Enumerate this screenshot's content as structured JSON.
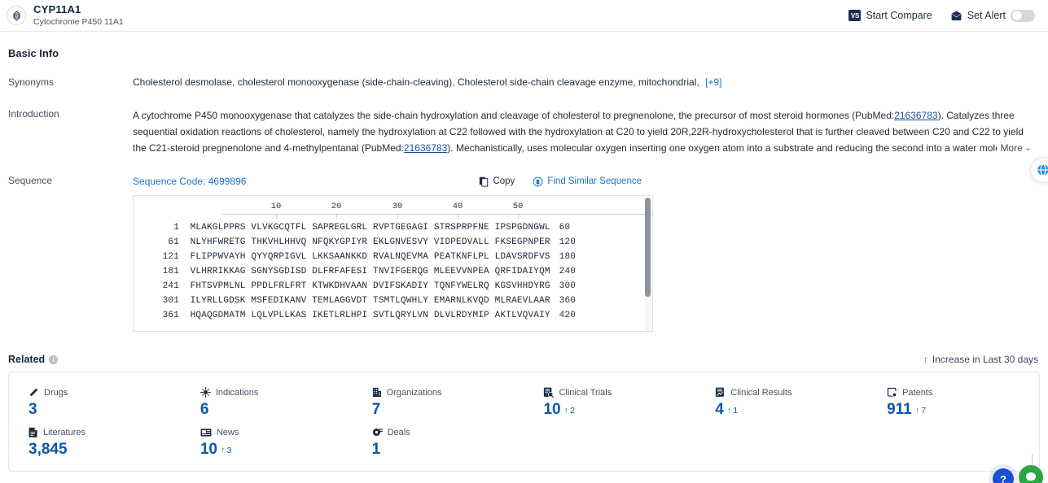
{
  "header": {
    "icon": "target-icon",
    "title": "CYP11A1",
    "subtitle": "Cytochrome P450 11A1",
    "compare_badge": "VS",
    "compare_label": "Start Compare",
    "alert_icon": "alert-envelope-icon",
    "alert_label": "Set Alert",
    "alert_toggle_state": "off"
  },
  "basic_info": {
    "section_title": "Basic Info",
    "synonyms": {
      "label": "Synonyms",
      "text": "Cholesterol desmolase,  cholesterol monooxygenase (side-chain-cleaving),  Cholesterol side-chain cleavage enzyme, mitochondrial,",
      "more_count": "[+9]"
    },
    "introduction": {
      "label": "Introduction",
      "part1": "A cytochrome P450 monooxygenase that catalyzes the side-chain hydroxylation and cleavage of cholesterol to pregnenolone, the precursor of most steroid hormones (PubMed:",
      "pubmed1": "21636783",
      "part2": "). Catalyzes three sequential oxidation reactions of cholesterol, namely the hydroxylation at C22 followed with the hydroxylation at C20 to yield 20R,22R-hydroxycholesterol that is further cleaved between C20 and C22 to yield the C21-steroid pregnenolone and 4-methylpentanal (PubMed:",
      "pubmed2": "21636783",
      "part3": "). Mechanistically, uses molecular oxygen inserting one oxygen atom into a substrate and reducing the second into a water molecule. Two electrons are provided",
      "more_label": "More",
      "more_chevron": "⌄"
    },
    "sequence": {
      "label": "Sequence",
      "code_label": "Sequence Code: 4699896",
      "copy_label": "Copy",
      "copy_icon": "copy-icon",
      "similar_label": "Find Similar Sequence",
      "similar_icon": "find-similar-icon",
      "ruler_ticks": [
        "10",
        "20",
        "30",
        "40",
        "50"
      ],
      "lines": [
        {
          "start": "1",
          "blocks": "MLAKGLPPRS VLVKGCQTFL SAPREGLGRL RVPTGEGAGI STRSPRPFNE IPSPGDNGWL",
          "end": "60"
        },
        {
          "start": "61",
          "blocks": "NLYHFWRETG THKVHLHHVQ NFQKYGPIYR EKLGNVESVY VIDPEDVALL FKSEGPNPER",
          "end": "120"
        },
        {
          "start": "121",
          "blocks": "FLIPPWVAYH QYYQRPIGVL LKKSAANKKD RVALNQEVMA PEATKNFLPL LDAVSRDFVS",
          "end": "180"
        },
        {
          "start": "181",
          "blocks": "VLHRRIKKAG SGNYSGDISD DLFRFAFESI TNVIFGERQG MLEEVVNPEA QRFIDAIYQM",
          "end": "240"
        },
        {
          "start": "241",
          "blocks": "FHTSVPMLNL PPDLFRLFRT KTWKDHVAAN DVIFSKADIY TQNFYWELRQ KGSVHHDYRG",
          "end": "300"
        },
        {
          "start": "301",
          "blocks": "ILYRLLGDSK MSFEDIKANV TEMLAGGVDT TSMTLQWHLY EMARNLKVQD MLRAEVLAAR",
          "end": "360"
        },
        {
          "start": "361",
          "blocks": "HQAQGDMATM LQLVPLLKAS IKETLRLHPI SVTLQRYLVN DLVLRDYMIP AKTLVQVAIY",
          "end": "420"
        }
      ]
    }
  },
  "related": {
    "title": "Related",
    "info_icon": "info-icon",
    "legend": "Increase in Last 30 days",
    "legend_arrow": "↑",
    "tiles": [
      {
        "icon": "pill-icon",
        "label": "Drugs",
        "value": "3",
        "delta": ""
      },
      {
        "icon": "virus-icon",
        "label": "Indications",
        "value": "6",
        "delta": ""
      },
      {
        "icon": "building-icon",
        "label": "Organizations",
        "value": "7",
        "delta": ""
      },
      {
        "icon": "clinical-trials-icon",
        "label": "Clinical Trials",
        "value": "10",
        "delta": "2"
      },
      {
        "icon": "clinical-results-icon",
        "label": "Clinical Results",
        "value": "4",
        "delta": "1"
      },
      {
        "icon": "patents-icon",
        "label": "Patents",
        "value": "911",
        "delta": "7"
      },
      {
        "icon": "literature-icon",
        "label": "Literatures",
        "value": "3,845",
        "delta": ""
      },
      {
        "icon": "news-icon",
        "label": "News",
        "value": "10",
        "delta": "3"
      },
      {
        "icon": "deals-icon",
        "label": "Deals",
        "value": "1",
        "delta": ""
      }
    ]
  },
  "floating": {
    "help_label": "?",
    "help_icon": "help-icon",
    "chat_icon": "chat-icon",
    "globe_icon": "globe-translate-icon"
  },
  "colors": {
    "accent_blue": "#0b58a8",
    "link_blue": "#1a73c7",
    "increase_green": "#2f9e44",
    "navy": "#1e3050"
  }
}
